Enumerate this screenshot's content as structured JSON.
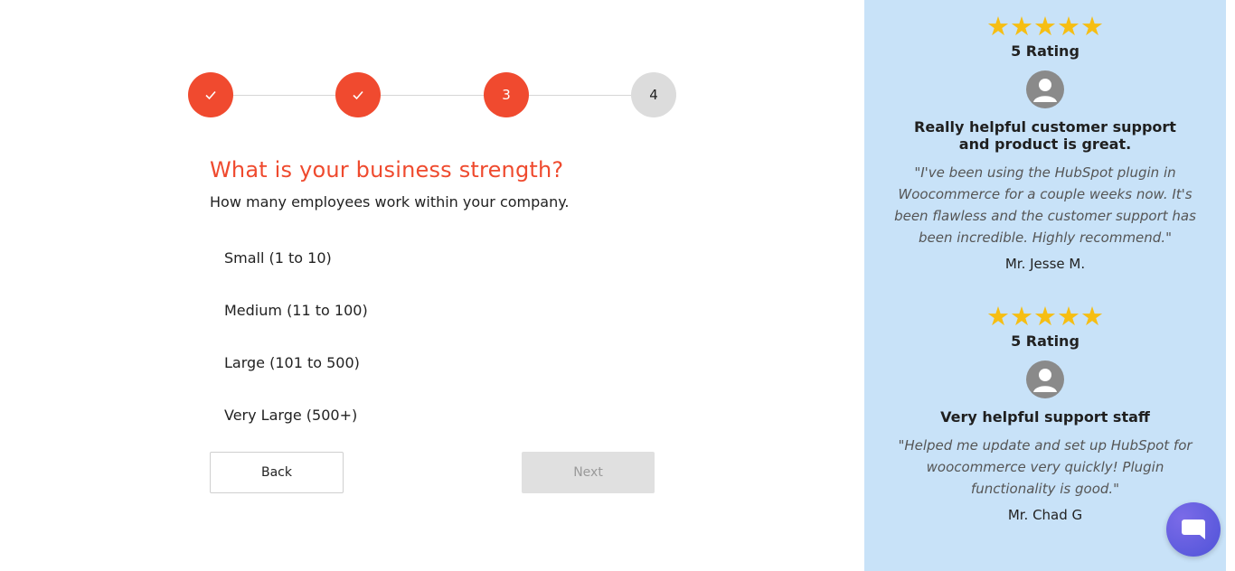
{
  "stepper": {
    "steps": [
      {
        "label": "",
        "state": "done"
      },
      {
        "label": "",
        "state": "done"
      },
      {
        "label": "3",
        "state": "active"
      },
      {
        "label": "4",
        "state": "pending"
      }
    ]
  },
  "question": {
    "title": "What is your business strength?",
    "subtitle": "How many employees work within your company.",
    "options": [
      "Small (1 to 10)",
      "Medium (11 to 100)",
      "Large (101 to 500)",
      "Very Large (500+)"
    ]
  },
  "buttons": {
    "back": "Back",
    "next": "Next"
  },
  "testimonials": [
    {
      "stars": "★★★★★",
      "rating": "5 Rating",
      "title": "Really helpful customer support and product is great.",
      "quote": "\"I've been using the HubSpot plugin in Woocommerce for a couple weeks now. It's been flawless and the customer support has been incredible. Highly recommend.\"",
      "author": "Mr. Jesse M."
    },
    {
      "stars": "★★★★★",
      "rating": "5 Rating",
      "title": "Very helpful support staff",
      "quote": "\"Helped me update and set up HubSpot for woocommerce very quickly! Plugin functionality is good.\"",
      "author": "Mr. Chad G"
    }
  ],
  "colors": {
    "accent": "#f04a2f",
    "panel_bg": "#c8e2f8",
    "star": "#f6be13",
    "chat": "#5b5fe0"
  },
  "icons": {
    "step_done": "checkmark-icon",
    "avatar": "user-avatar-icon",
    "chat": "chat-bubble-icon"
  }
}
